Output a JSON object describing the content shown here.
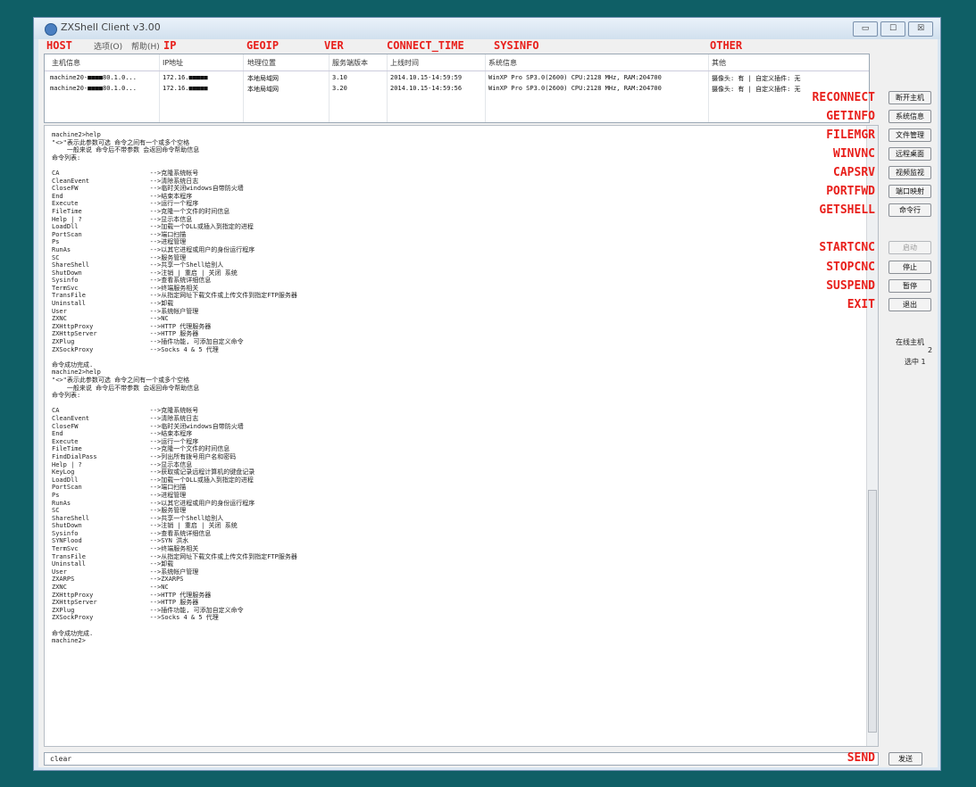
{
  "window": {
    "title": "ZXShell Client v3.00",
    "controls": [
      "▭",
      "☐",
      "☒"
    ]
  },
  "menu": [
    "选项(O)",
    "帮助(H)"
  ],
  "overlay_headers": [
    "HOST",
    "IP",
    "GEOIP",
    "VER",
    "CONNECT_TIME",
    "SYSINFO",
    "OTHER"
  ],
  "list": {
    "columns": [
      "主机信息",
      "IP地址",
      "地理位置",
      "服务端版本",
      "上线时间",
      "系统信息",
      "其他"
    ],
    "rows": [
      [
        "machine20-■■■■80.1.0...",
        "172.16.■■■■■",
        "本地局域网",
        "3.10",
        "2014.10.15-14:59:59",
        "WinXP Pro SP3.0(2600) CPU:2128 MHz, RAM:204700",
        "摄像头: 有 | 自定义插件: 无"
      ],
      [
        "machine20-■■■■80.1.0...",
        "172.16.■■■■■",
        "本地局域网",
        "3.20",
        "2014.10.15-14:59:56",
        "WinXP Pro SP3.0(2600) CPU:2128 MHz, RAM:204700",
        "摄像头: 有 | 自定义插件: 无"
      ]
    ]
  },
  "console_text": "machine2>help\n\"<>\"表示此参数可选 命令之间有一个或多个空格\n    一般来说 命令后不带参数 会返回命令帮助信息\n命令列表:\n\nCA                        -->克隆系统帐号\nCleanEvent                -->清除系统日志\nCloseFW                   -->临时关闭windows自带防火墙\nEnd                       -->结束本程序\nExecute                   -->运行一个程序\nFileTime                  -->克隆一个文件的时间信息\nHelp | ?                  -->显示本信息\nLoadDll                   -->加载一个DLL或插入到指定的进程\nPortScan                  -->端口扫描\nPs                        -->进程管理\nRunAs                     -->以其它进程或用户的身份运行程序\nSC                        -->服务管理\nShareShell                -->共享一个Shell给别人\nShutDown                  -->注销 | 重启 | 关闭 系统\nSysinfo                   -->查看系统详细信息\nTermSvc                   -->终端服务相关\nTransFile                 -->从指定网址下载文件或上传文件到指定FTP服务器\nUninstall                 -->卸载\nUser                      -->系统帐户管理\nZXNC                      -->NC\nZXHttpProxy               -->HTTP 代理服务器\nZXHttpServer              -->HTTP 服务器\nZXPlug                    -->插件功能, 可添加自定义命令\nZXSockProxy               -->Socks 4 & 5 代理\n\n命令成功完成.\nmachine2>help\n\"<>\"表示此参数可选 命令之间有一个或多个空格\n    一般来说 命令后不带参数 会返回命令帮助信息\n命令列表:\n\nCA                        -->克隆系统帐号\nCleanEvent                -->清除系统日志\nCloseFW                   -->临时关闭windows自带防火墙\nEnd                       -->结束本程序\nExecute                   -->运行一个程序\nFileTime                  -->克隆一个文件的时间信息\nFindDialPass              -->列出所有拨号用户名和密码\nHelp | ?                  -->显示本信息\nKeyLog                    -->获取或记录远程计算机的键盘记录\nLoadDll                   -->加载一个DLL或插入到指定的进程\nPortScan                  -->端口扫描\nPs                        -->进程管理\nRunAs                     -->以其它进程或用户的身份运行程序\nSC                        -->服务管理\nShareShell                -->共享一个Shell给别人\nShutDown                  -->注销 | 重启 | 关闭 系统\nSysinfo                   -->查看系统详细信息\nSYNFlood                  -->SYN 洪水\nTermSvc                   -->终端服务相关\nTransFile                 -->从指定网址下载文件或上传文件到指定FTP服务器\nUninstall                 -->卸载\nUser                      -->系统帐户管理\nZXARPS                    -->ZXARPS\nZXNC                      -->NC\nZXHttpProxy               -->HTTP 代理服务器\nZXHttpServer              -->HTTP 服务器\nZXPlug                    -->插件功能, 可添加自定义命令\nZXSockProxy               -->Socks 4 & 5 代理\n\n命令成功完成.\nmachine2>",
  "input": {
    "value": "clear"
  },
  "buttons": {
    "reconnect": "断开主机",
    "getinfo": "系统信息",
    "filemgr": "文件管理",
    "winvnc": "远程桌面",
    "capsrv": "视频监视",
    "portfwd": "端口映射",
    "getshell": "命令行",
    "startcnc": "启动",
    "stopcnc": "停止",
    "suspend": "暂停",
    "exit": "退出",
    "send": "发送"
  },
  "overlay_labels": {
    "reconnect": "RECONNECT",
    "getinfo": "GETINFO",
    "filemgr": "FILEMGR",
    "winvnc": "WINVNC",
    "capsrv": "CAPSRV",
    "portfwd": "PORTFWD",
    "getshell": "GETSHELL",
    "startcnc": "STARTCNC",
    "stopcnc": "STOPCNC",
    "suspend": "SUSPEND",
    "exit": "EXIT",
    "send": "SEND"
  },
  "status": {
    "online_label": "在线主机",
    "online_count": "2",
    "selected": "选中 1"
  },
  "colors": {
    "background": "#0f5f66",
    "overlay": "#e8201c"
  }
}
